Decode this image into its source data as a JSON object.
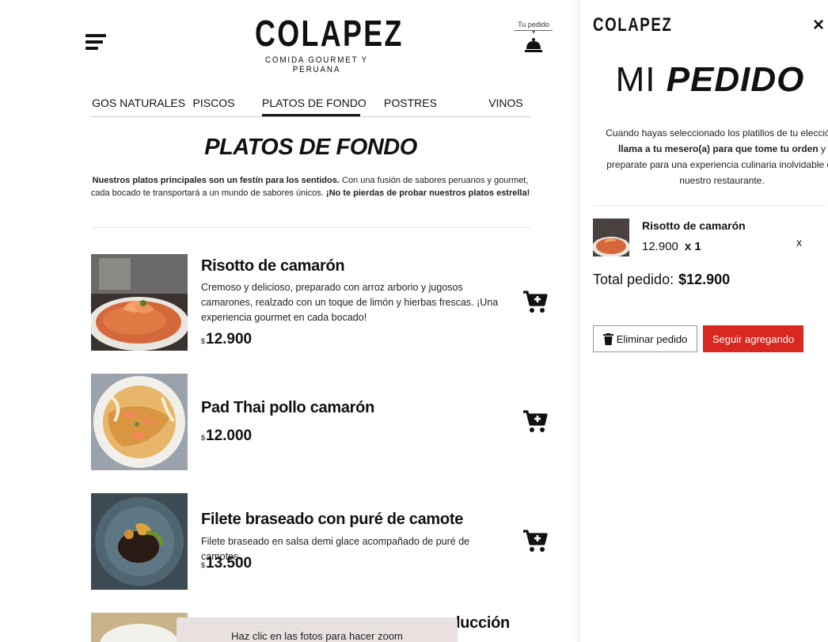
{
  "brand": {
    "name": "COLAPEZ",
    "tagline": "COMIDA GOURMET Y PERUANA"
  },
  "header": {
    "order_label": "Tu pedido"
  },
  "tabs": [
    {
      "label": "JUGOS NATURALES"
    },
    {
      "label": "PISCOS"
    },
    {
      "label": "PLATOS DE FONDO",
      "active": true
    },
    {
      "label": "POSTRES"
    },
    {
      "label": "VINOS"
    }
  ],
  "section": {
    "title": "PLATOS DE FONDO",
    "desc_bold_1": "Nuestros platos principales son un festín para los sentidos.",
    "desc_text": " Con una fusión de sabores peruanos y gourmet, cada bocado te transportará a un mundo de sabores únicos. ",
    "desc_bold_2": "¡No te pierdas de probar nuestros platos estrella!"
  },
  "dishes": [
    {
      "name": "Risotto de camarón",
      "description": "Cremoso y delicioso, preparado con arroz arborio y jugosos camarones, realzado con un toque de limón y hierbas frescas. ¡Una experiencia gourmet en cada bocado!",
      "currency": "$",
      "price": "12.900"
    },
    {
      "name": "Pad Thai pollo camarón",
      "description": "",
      "currency": "$",
      "price": "12.000"
    },
    {
      "name": "Filete braseado con puré de camote",
      "description": "Filete braseado en salsa demi glace acompañado de puré de camotes.",
      "currency": "$",
      "price": "13.500"
    },
    {
      "name": "lucción"
    }
  ],
  "toast": {
    "text": "Haz clic en las fotos para hacer zoom"
  },
  "order_panel": {
    "brand": "COLAPEZ",
    "close_label": "×",
    "title_part1": "MI",
    "title_part2": "PEDIDO",
    "info_1": "Cuando hayas seleccionado los platillos de tu elección, ",
    "info_bold": "llama a tu mesero(a) para que tome tu orden",
    "info_2": " y preparate para una experiencia culinaria inolvidable en nuestro restaurante.",
    "items": [
      {
        "name": "Risotto de camarón",
        "price": "12.900",
        "qty": "x 1",
        "remove": "x"
      }
    ],
    "total_label": "Total pedido:",
    "total_value": "$12.900",
    "clear_label": "Eliminar pedido",
    "continue_label": "Seguir agregando"
  },
  "colors": {
    "accent": "#d8281f",
    "text": "#111111",
    "toast_bg": "#e9e0e0"
  }
}
